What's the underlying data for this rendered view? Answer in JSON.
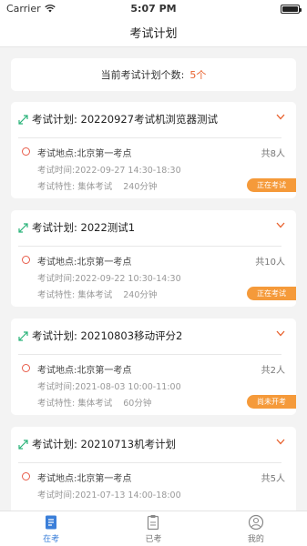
{
  "status_bar": {
    "carrier": "Carrier",
    "time": "5:07 PM"
  },
  "nav": {
    "title": "考试计划"
  },
  "summary": {
    "label": "当前考试计划个数:",
    "count": "5个"
  },
  "plans": [
    {
      "title": "考试计划: 20220927考试机浏览器测试",
      "location": "考试地点:北京第一考点",
      "people": "共8人",
      "time": "考试时间:2022-09-27 14:30-18:30",
      "feature": "考试特性: 集体考试",
      "duration": "240分钟",
      "status": "正在考试"
    },
    {
      "title": "考试计划: 2022测试1",
      "location": "考试地点:北京第一考点",
      "people": "共10人",
      "time": "考试时间:2022-09-22 10:30-14:30",
      "feature": "考试特性: 集体考试",
      "duration": "240分钟",
      "status": "正在考试"
    },
    {
      "title": "考试计划: 20210803移动评分2",
      "location": "考试地点:北京第一考点",
      "people": "共2人",
      "time": "考试时间:2021-08-03 10:00-11:00",
      "feature": "考试特性: 集体考试",
      "duration": "60分钟",
      "status": "尚未开考"
    },
    {
      "title": "考试计划: 20210713机考计划",
      "location": "考试地点:北京第一考点",
      "people": "共5人",
      "time": "考试时间:2021-07-13 14:00-18:00",
      "feature": "",
      "duration": "",
      "status": ""
    }
  ],
  "tabs": [
    {
      "label": "在考",
      "icon": "document-list-icon",
      "active": true
    },
    {
      "label": "已考",
      "icon": "clipboard-icon",
      "active": false
    },
    {
      "label": "我的",
      "icon": "user-icon",
      "active": false
    }
  ],
  "colors": {
    "accent": "#3b7fd9",
    "badge": "#f59a3a",
    "count": "#e8602c",
    "dot": "#e85c4a",
    "expand": "#2bb37a"
  }
}
